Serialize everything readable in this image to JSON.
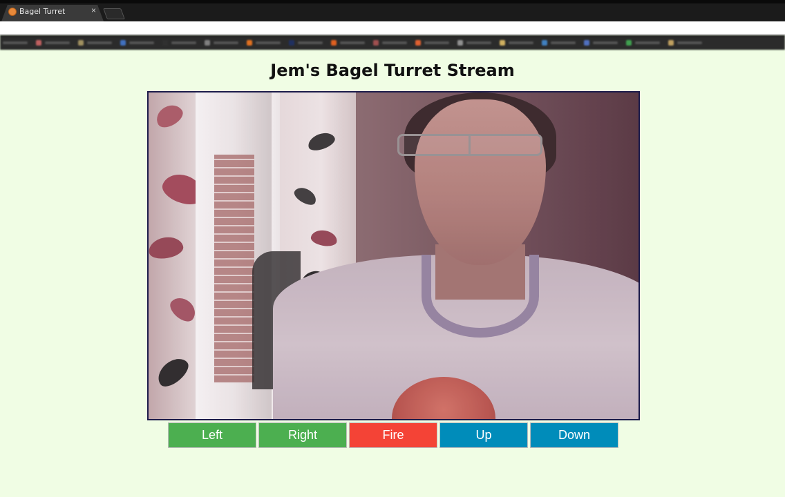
{
  "browser": {
    "tab_title": "Bagel Turret",
    "tab_close": "×",
    "favicon": "bagel-icon"
  },
  "page": {
    "title": "Jem's Bagel Turret Stream"
  },
  "stream": {
    "description": "webcam-stream"
  },
  "controls": [
    {
      "label": "Left",
      "color": "#4caf50"
    },
    {
      "label": "Right",
      "color": "#4caf50"
    },
    {
      "label": "Fire",
      "color": "#f44336"
    },
    {
      "label": "Up",
      "color": "#008cba"
    },
    {
      "label": "Down",
      "color": "#008cba"
    }
  ],
  "colors": {
    "page_background": "#f0fde4",
    "stream_border": "#1b1b4a"
  }
}
